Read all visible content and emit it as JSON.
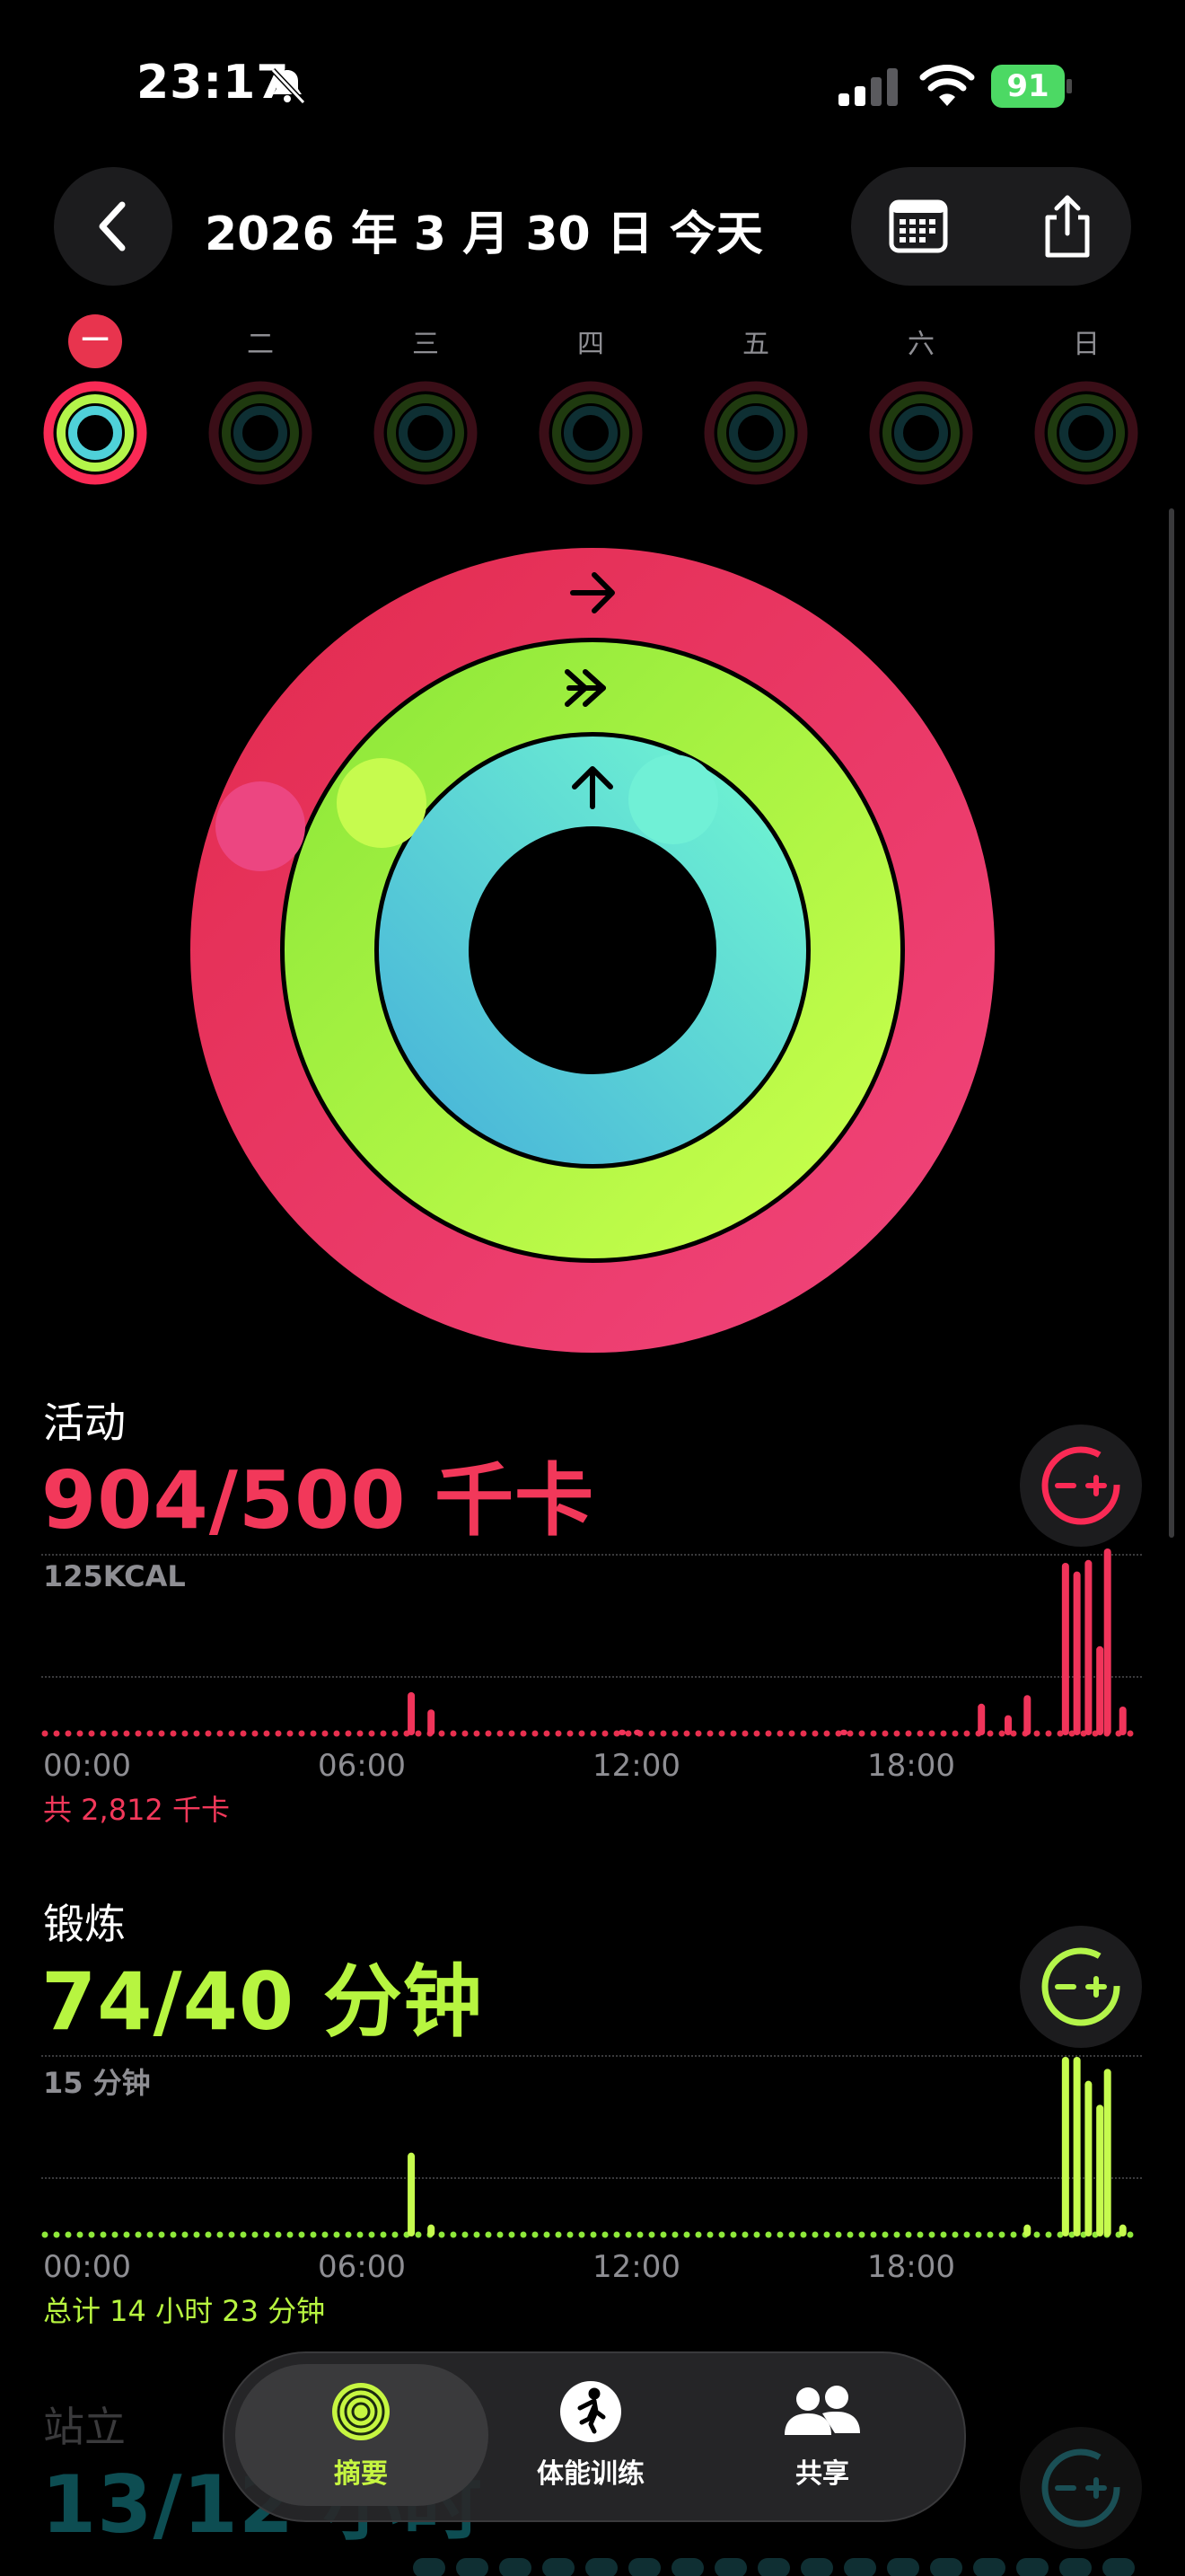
{
  "status_bar": {
    "time": "23:17",
    "battery": "91"
  },
  "header": {
    "date_title": "2026 年 3 月 30 日 今天"
  },
  "week": [
    {
      "label": "一",
      "today": true
    },
    {
      "label": "二",
      "today": false
    },
    {
      "label": "三",
      "today": false
    },
    {
      "label": "四",
      "today": false
    },
    {
      "label": "五",
      "today": false
    },
    {
      "label": "六",
      "today": false
    },
    {
      "label": "日",
      "today": false
    }
  ],
  "rings": {
    "move_progress": 1.808,
    "exercise_progress": 1.85,
    "stand_progress": 1.083
  },
  "colors": {
    "move": "#fa2a55",
    "move_text": "#f2385a",
    "exercise": "#b4f54a",
    "exercise_text": "#b7f540",
    "stand": "#4fd1d9"
  },
  "activity": {
    "title": "活动",
    "value": "904/500 千卡",
    "scale": "125KCAL",
    "total": "共 2,812 千卡",
    "ticks": [
      "00:00",
      "06:00",
      "12:00",
      "18:00"
    ]
  },
  "exercise": {
    "title": "锻炼",
    "value": "74/40 分钟",
    "scale": "15 分钟",
    "total": "总计 14 小时 23 分钟",
    "ticks": [
      "00:00",
      "06:00",
      "12:00",
      "18:00"
    ]
  },
  "stand": {
    "title": "站立",
    "value": "13/12 小时"
  },
  "tab_bar": {
    "tabs": [
      {
        "label": "摘要",
        "icon": "rings-icon",
        "active": true
      },
      {
        "label": "体能训练",
        "icon": "running-icon",
        "active": false
      },
      {
        "label": "共享",
        "icon": "people-icon",
        "active": false
      }
    ]
  },
  "chart_data": [
    {
      "type": "bar",
      "title": "活动",
      "ylabel": "125KCAL",
      "x_range": [
        "00:00",
        "24:00"
      ],
      "ylim": [
        0,
        125
      ],
      "series": [
        {
          "values": [
            {
              "x": "08:04",
              "y": 30
            },
            {
              "x": "08:30",
              "y": 18
            },
            {
              "x": "12:40",
              "y": 4
            },
            {
              "x": "13:00",
              "y": 4
            },
            {
              "x": "17:30",
              "y": 4
            },
            {
              "x": "20:30",
              "y": 22
            },
            {
              "x": "21:05",
              "y": 14
            },
            {
              "x": "21:30",
              "y": 28
            },
            {
              "x": "22:20",
              "y": 120
            },
            {
              "x": "22:35",
              "y": 114
            },
            {
              "x": "22:50",
              "y": 122
            },
            {
              "x": "23:05",
              "y": 62
            },
            {
              "x": "23:15",
              "y": 130
            },
            {
              "x": "23:35",
              "y": 20
            }
          ]
        }
      ]
    },
    {
      "type": "bar",
      "title": "锻炼",
      "ylabel": "15 分钟",
      "x_range": [
        "00:00",
        "24:00"
      ],
      "ylim": [
        0,
        15
      ],
      "series": [
        {
          "values": [
            {
              "x": "08:04",
              "y": 7
            },
            {
              "x": "08:30",
              "y": 1
            },
            {
              "x": "21:30",
              "y": 1
            },
            {
              "x": "22:20",
              "y": 15
            },
            {
              "x": "22:35",
              "y": 15
            },
            {
              "x": "22:50",
              "y": 13
            },
            {
              "x": "23:05",
              "y": 11
            },
            {
              "x": "23:15",
              "y": 14
            },
            {
              "x": "23:35",
              "y": 1
            }
          ]
        }
      ]
    }
  ]
}
